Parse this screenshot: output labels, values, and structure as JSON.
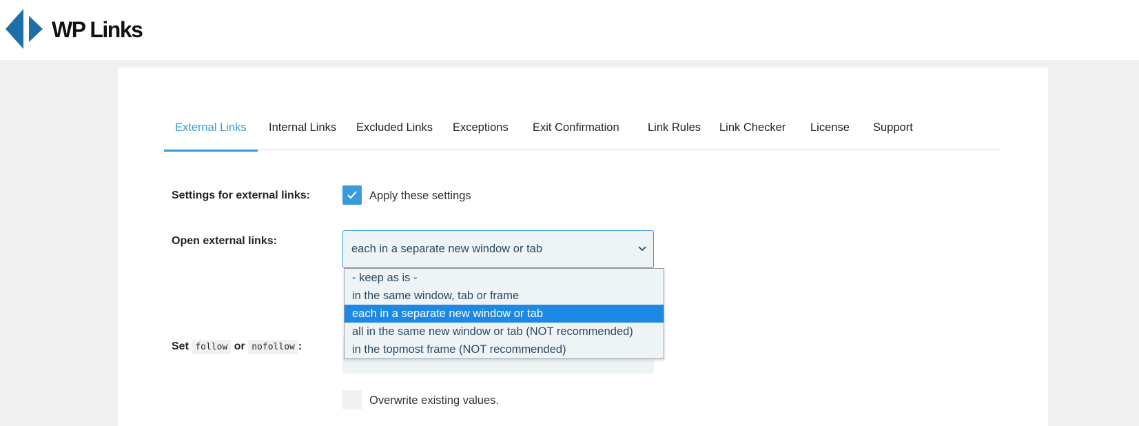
{
  "brand": {
    "name": "WP Links",
    "accent": "#3a9bd9",
    "logo_color": "#1e6fa8"
  },
  "tabs": [
    {
      "label": "External Links",
      "active": true
    },
    {
      "label": "Internal Links",
      "active": false
    },
    {
      "label": "Excluded Links",
      "active": false
    },
    {
      "label": "Exceptions",
      "active": false
    },
    {
      "label": "Exit Confirmation",
      "active": false
    },
    {
      "label": "Link Rules",
      "active": false
    },
    {
      "label": "Link Checker",
      "active": false
    },
    {
      "label": "License",
      "active": false
    },
    {
      "label": "Support",
      "active": false
    }
  ],
  "settings": {
    "external_label": "Settings for external links:",
    "apply_label": "Apply these settings",
    "apply_checked": true,
    "open_label": "Open external links:",
    "open_value": "each in a separate new window or tab",
    "follow_label_prefix": "Set",
    "follow_code": "follow",
    "follow_or": "or",
    "nofollow_code": "nofollow",
    "follow_label_suffix": ":",
    "overwrite_label": "Overwrite existing values.",
    "overwrite_checked": false
  },
  "dropdown": {
    "options": [
      "- keep as is -",
      "in the same window, tab or frame",
      "each in a separate new window or tab",
      "all in the same new window or tab (NOT recommended)",
      "in the topmost frame (NOT recommended)"
    ],
    "selected_index": 2
  },
  "icons": {
    "logo": "wp-links-logo-icon",
    "check": "check-icon",
    "chevron": "chevron-down-icon"
  }
}
